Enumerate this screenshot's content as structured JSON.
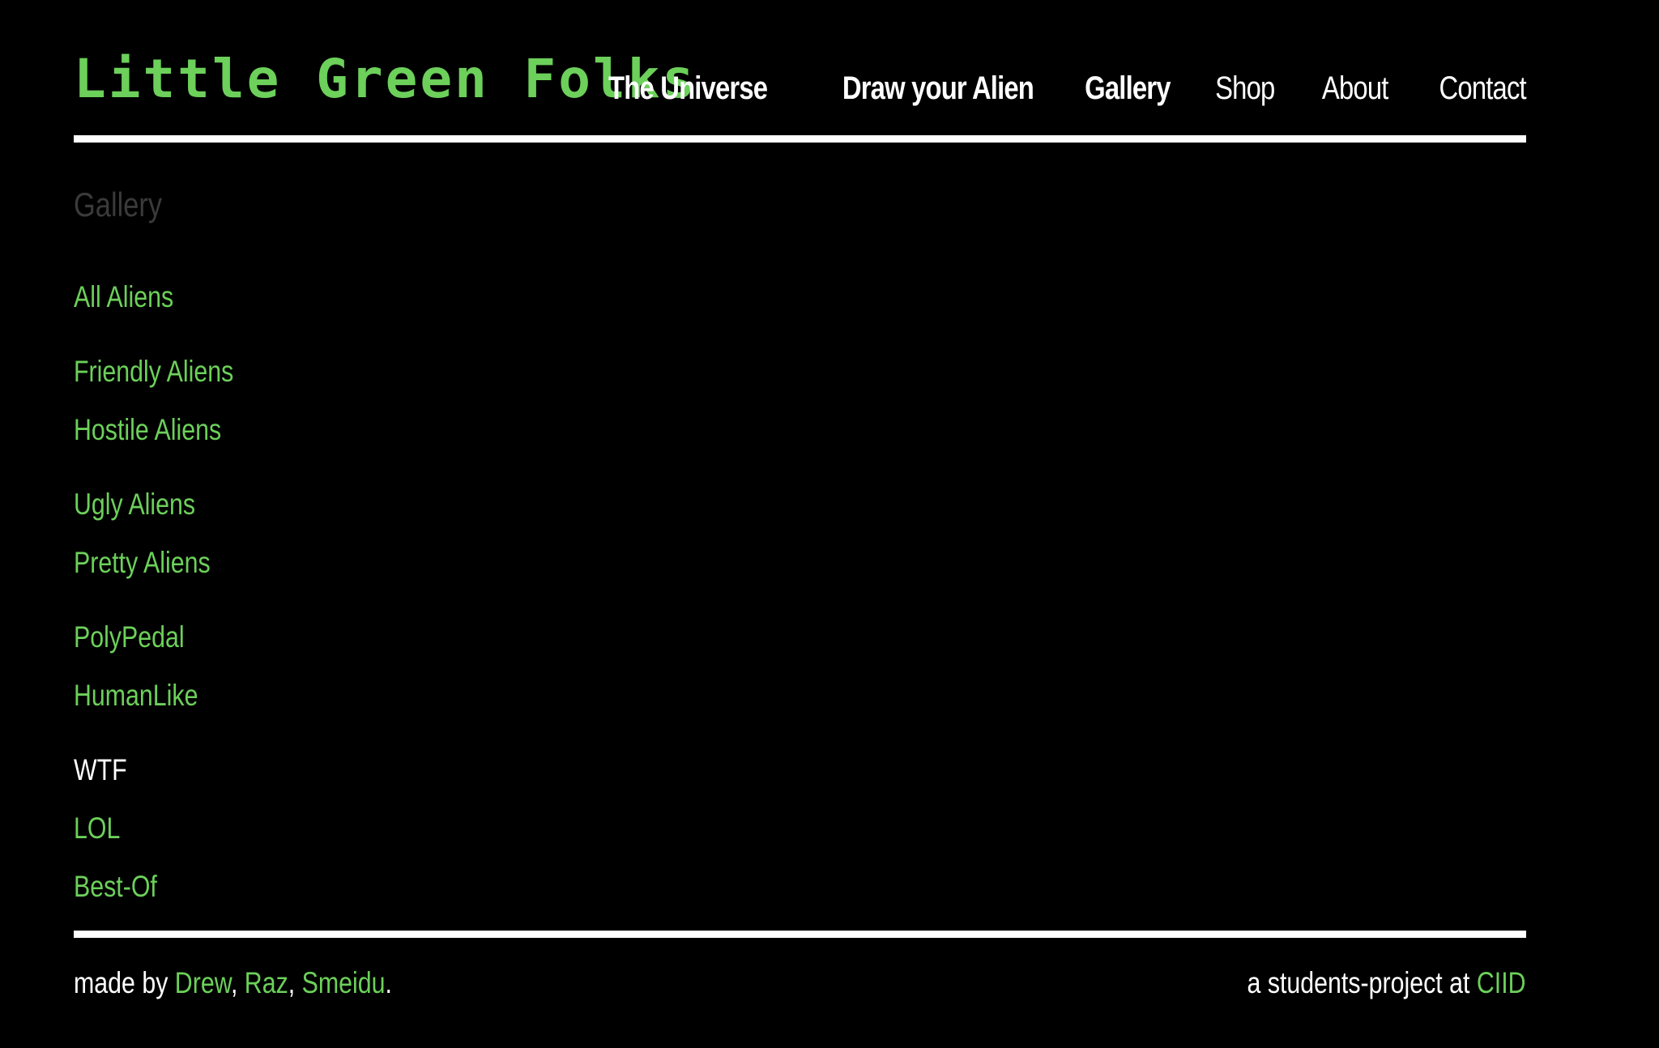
{
  "site": {
    "title": "Little Green Folks"
  },
  "nav": {
    "items": [
      {
        "label": "The Universe"
      },
      {
        "label": "Draw your Alien"
      },
      {
        "label": "Gallery"
      },
      {
        "label": "Shop"
      },
      {
        "label": "About"
      },
      {
        "label": "Contact"
      }
    ]
  },
  "gallery": {
    "heading": "Gallery",
    "items": [
      {
        "label": "All Aliens"
      },
      {
        "label": "Friendly Aliens"
      },
      {
        "label": "Hostile Aliens"
      },
      {
        "label": "Ugly Aliens"
      },
      {
        "label": "Pretty Aliens"
      },
      {
        "label": "PolyPedal"
      },
      {
        "label": "HumanLike"
      },
      {
        "label": "WTF"
      },
      {
        "label": "LOL"
      },
      {
        "label": "Best-Of"
      }
    ]
  },
  "footer": {
    "made_by_prefix": "made by ",
    "authors": [
      "Drew",
      "Raz",
      "Smeidu"
    ],
    "separator": ", ",
    "end": ".",
    "project_prefix": "a students-project at ",
    "institution": "CIID"
  },
  "colors": {
    "background": "#000000",
    "accent_green": "#6cd05a",
    "text": "#ffffff",
    "heading_muted": "#3a3a3a"
  }
}
